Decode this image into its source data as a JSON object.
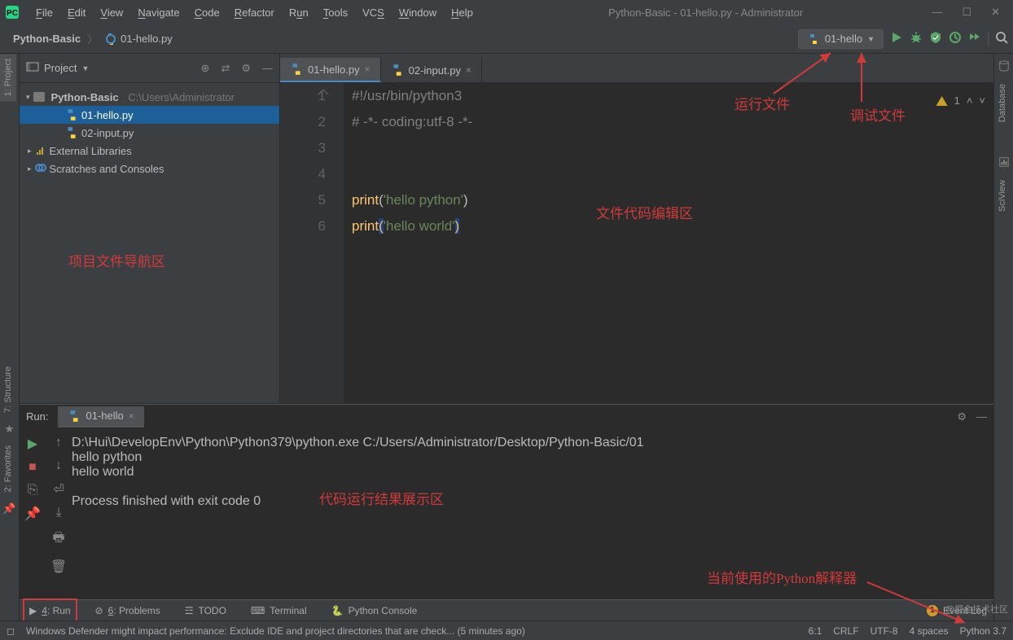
{
  "window": {
    "title": "Python-Basic - 01-hello.py - Administrator"
  },
  "menu": {
    "file": "File",
    "edit": "Edit",
    "view": "View",
    "navigate": "Navigate",
    "code": "Code",
    "refactor": "Refactor",
    "run": "Run",
    "tools": "Tools",
    "vcs": "VCS",
    "window": "Window",
    "help": "Help"
  },
  "breadcrumb": {
    "root": "Python-Basic",
    "file": "01-hello.py"
  },
  "run_config": {
    "name": "01-hello"
  },
  "project": {
    "header": "Project",
    "root": "Python-Basic",
    "root_path": "C:\\Users\\Administrator",
    "files": [
      "01-hello.py",
      "02-input.py"
    ],
    "external": "External Libraries",
    "scratches": "Scratches and Consoles"
  },
  "tabs": {
    "tab1": "01-hello.py",
    "tab2": "02-input.py"
  },
  "editor": {
    "line1": "#!/usr/bin/python3",
    "line2": "# -*- coding:utf-8 -*-",
    "line5a": "print",
    "line5b": "(",
    "line5c": "'hello python'",
    "line5d": ")",
    "line6a": "print",
    "line6b": "(",
    "line6c": "'hello world'",
    "line6d": ")",
    "warn_count": "1"
  },
  "run_panel": {
    "title": "Run:",
    "tab": "01-hello",
    "output_line1": "D:\\Hui\\DevelopEnv\\Python\\Python379\\python.exe C:/Users/Administrator/Desktop/Python-Basic/01",
    "output_line2": "hello python",
    "output_line3": "hello world",
    "output_line5": "Process finished with exit code 0"
  },
  "bottom_tabs": {
    "run": "4: Run",
    "problems": "6: Problems",
    "todo": "TODO",
    "terminal": "Terminal",
    "pyconsole": "Python Console",
    "event_log": "Event Log"
  },
  "statusbar": {
    "msg": "Windows Defender might impact performance: Exclude IDE and project directories that are check... (5 minutes ago)",
    "pos": "6:1",
    "sep": "CRLF",
    "enc": "UTF-8",
    "indent": "4 spaces",
    "interp": "Python 3.7"
  },
  "side_tools": {
    "project": "1: Project",
    "structure": "7: Structure",
    "favorites": "2: Favorites",
    "database": "Database",
    "sciview": "SciView"
  },
  "annotations": {
    "nav": "项目文件导航区",
    "editor": "文件代码编辑区",
    "run_file": "运行文件",
    "debug_file": "调试文件",
    "run_output": "代码运行结果展示区",
    "interp": "当前使用的Python解释器"
  },
  "watermark": "@掘金技术社区"
}
